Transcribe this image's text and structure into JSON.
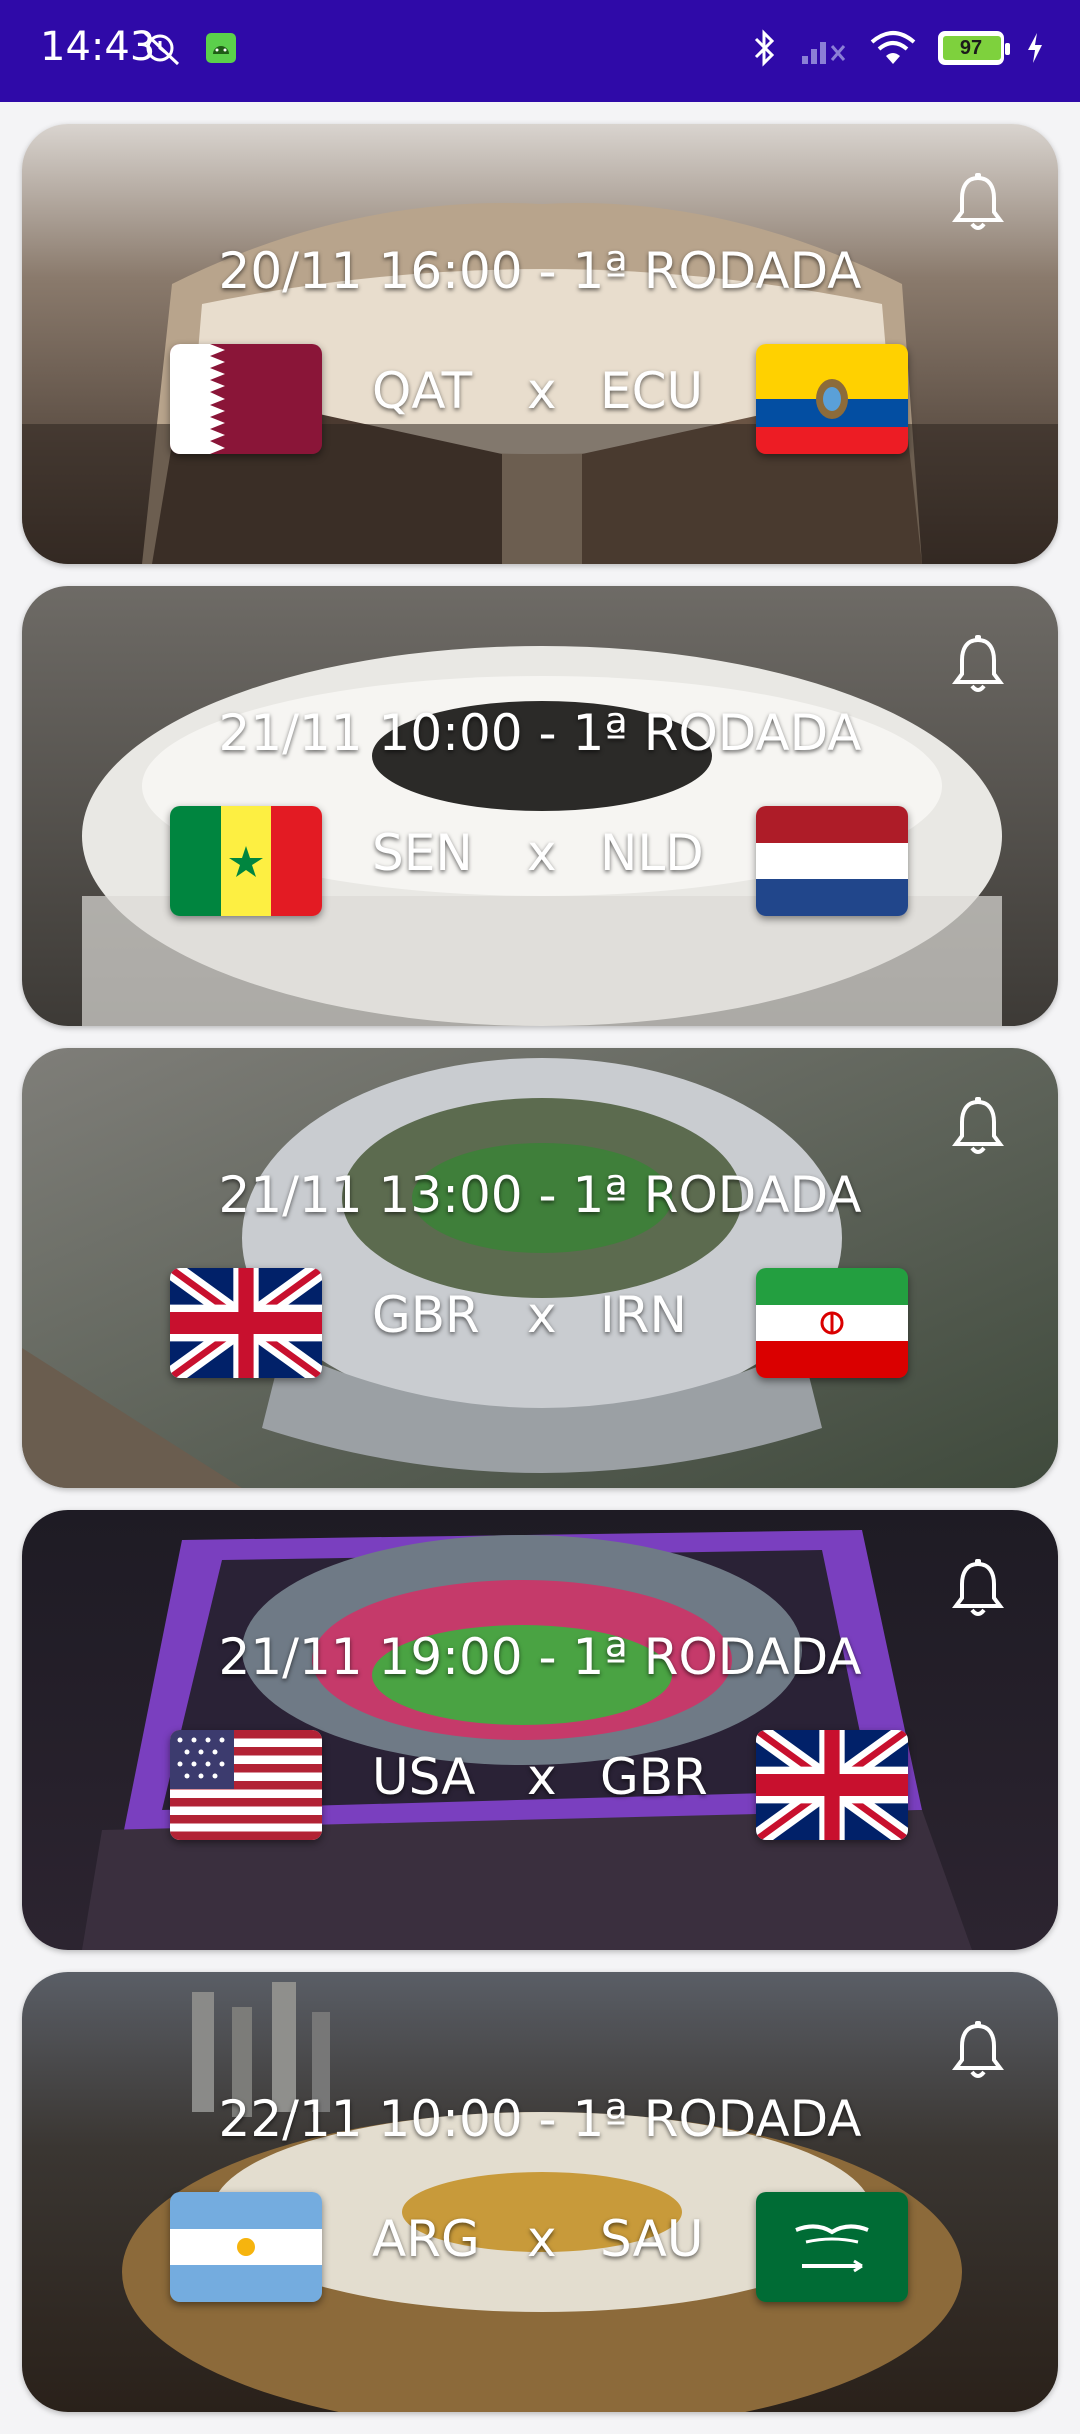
{
  "status_bar": {
    "time": "14:43",
    "battery_level": "97",
    "background_color": "#2f0aa8",
    "icons": [
      "muted-alarm-icon",
      "android-notification-icon",
      "bluetooth-icon",
      "signal-icon",
      "wifi-icon",
      "battery-icon",
      "charging-icon"
    ]
  },
  "matches": [
    {
      "header": "20/11 16:00 - 1ª RODADA",
      "home": "QAT",
      "vs": "x",
      "away": "ECU",
      "home_flag": "qatar-flag",
      "away_flag": "ecuador-flag",
      "bell": "bell-icon"
    },
    {
      "header": "21/11 10:00 - 1ª RODADA",
      "home": "SEN",
      "vs": "x",
      "away": "NLD",
      "home_flag": "senegal-flag",
      "away_flag": "netherlands-flag",
      "bell": "bell-icon"
    },
    {
      "header": "21/11 13:00 - 1ª RODADA",
      "home": "GBR",
      "vs": "x",
      "away": "IRN",
      "home_flag": "united-kingdom-flag",
      "away_flag": "iran-flag",
      "bell": "bell-icon"
    },
    {
      "header": "21/11 19:00 - 1ª RODADA",
      "home": "USA",
      "vs": "x",
      "away": "GBR",
      "home_flag": "usa-flag",
      "away_flag": "united-kingdom-flag",
      "bell": "bell-icon"
    },
    {
      "header": "22/11 10:00 - 1ª RODADA",
      "home": "ARG",
      "vs": "x",
      "away": "SAU",
      "home_flag": "argentina-flag",
      "away_flag": "saudi-arabia-flag",
      "bell": "bell-icon"
    }
  ]
}
